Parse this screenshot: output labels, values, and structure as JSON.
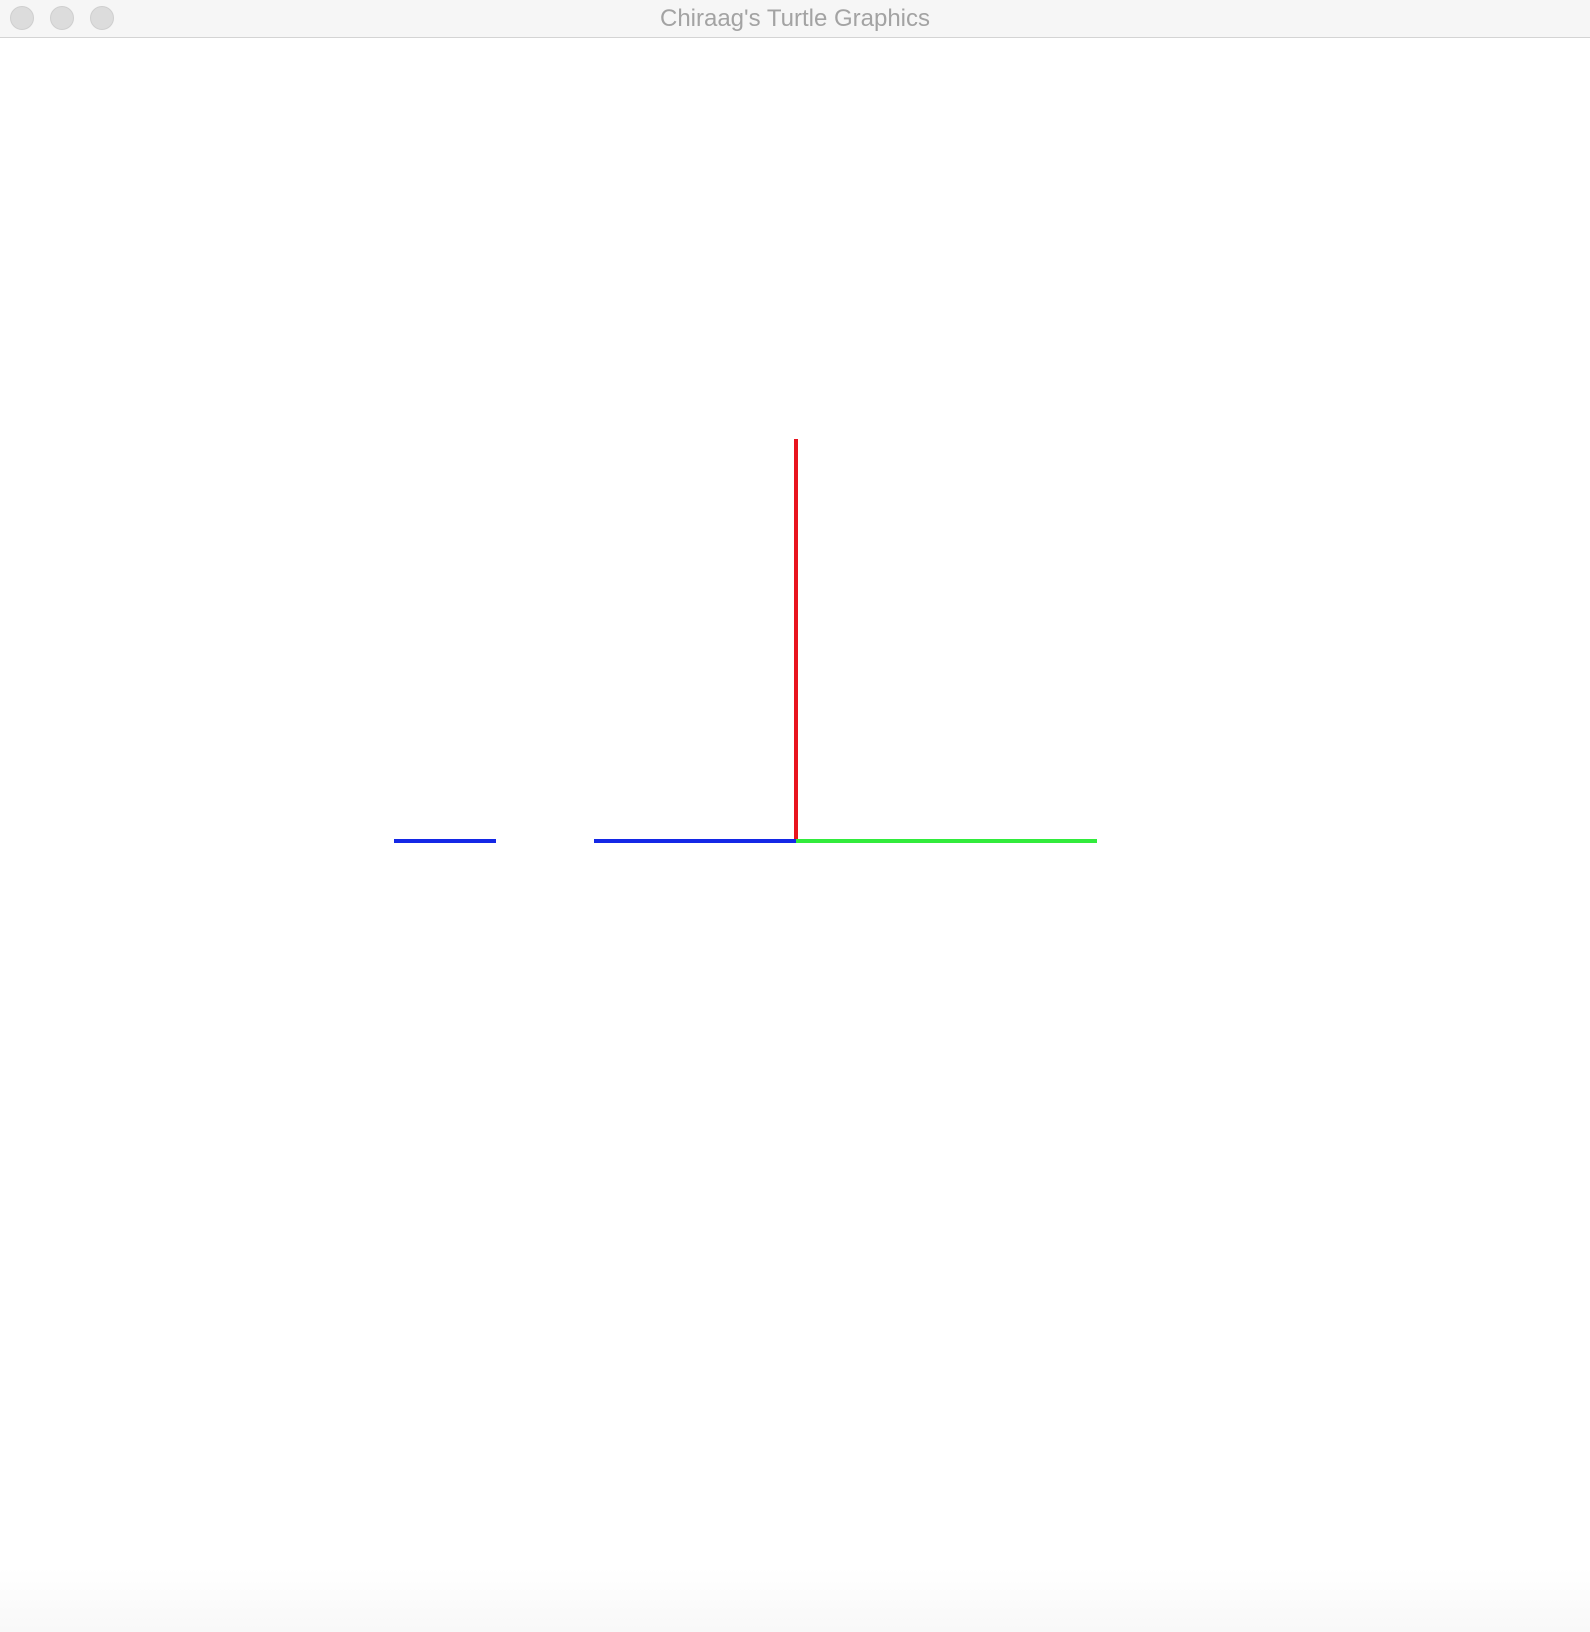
{
  "window": {
    "title": "Chiraag's Turtle Graphics"
  },
  "controls": [
    {
      "name": "close",
      "icon": "close-icon"
    },
    {
      "name": "minimize",
      "icon": "minimize-icon"
    },
    {
      "name": "zoom",
      "icon": "zoom-icon"
    }
  ],
  "colors": {
    "titlebar_bg": "#f6f6f6",
    "title_text": "#a3a3a3",
    "canvas_bg": "#ffffff"
  },
  "drawing": {
    "strokes": [
      {
        "name": "stroke-red-vertical",
        "color": "#e8141e"
      },
      {
        "name": "stroke-blue-long",
        "color": "#1428e6"
      },
      {
        "name": "stroke-blue-short",
        "color": "#1428e6"
      },
      {
        "name": "stroke-green",
        "color": "#32eb3c"
      }
    ]
  }
}
